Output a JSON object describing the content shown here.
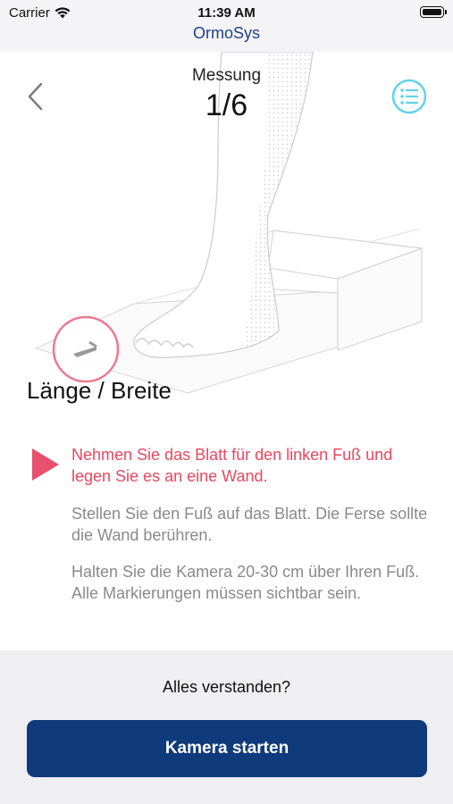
{
  "status_bar": {
    "carrier": "Carrier",
    "time": "11:39 AM",
    "icons": [
      "wifi-icon",
      "battery-icon"
    ]
  },
  "app": {
    "title": "OrmoSys"
  },
  "header": {
    "label": "Messung",
    "step": "1/6",
    "back_icon": "chevron-left-icon",
    "menu_icon": "list-icon"
  },
  "section": {
    "title": "Länge / Breite"
  },
  "instructions": {
    "active": "Nehmen Sie das Blatt für den linken Fuß und legen Sie es an eine Wand.",
    "step2": "Stellen Sie den Fuß auf das Blatt. Die Ferse sollte die Wand berühren.",
    "step3": "Halten Sie die Kamera 20-30 cm über Ihren Fuß. Alle Markierungen müssen sichtbar sein."
  },
  "footer": {
    "question": "Alles verstanden?",
    "button_label": "Kamera starten"
  },
  "colors": {
    "brand": "#1d3f8a",
    "button": "#0f3b7c",
    "accent": "#e8485f",
    "menu_icon": "#5fd3e8",
    "muted_text": "#8a8a8a"
  }
}
